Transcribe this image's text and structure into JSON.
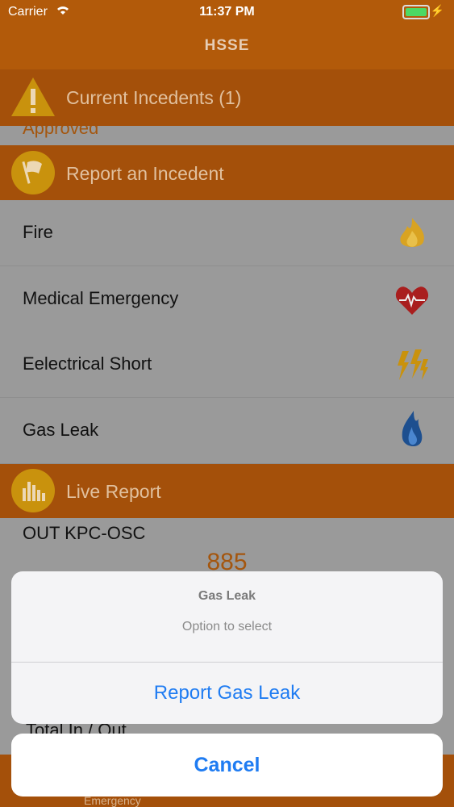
{
  "status_bar": {
    "carrier": "Carrier",
    "time": "11:37 PM"
  },
  "nav": {
    "title": "HSSE"
  },
  "current": {
    "label": "Current Incedents (1)",
    "status_text": "Approved"
  },
  "report": {
    "label": "Report an Incedent",
    "items": [
      {
        "label": "Fire",
        "icon": "fire-icon"
      },
      {
        "label": "Medical Emergency",
        "icon": "heartbeat-icon"
      },
      {
        "label": "Eelectrical Short",
        "icon": "lightning-icon"
      },
      {
        "label": "Gas Leak",
        "icon": "gas-flame-icon"
      }
    ]
  },
  "live": {
    "label": "Live Report",
    "row1_label": "OUT KPC-OSC",
    "row1_value": "885",
    "total_label": "Total In / Out"
  },
  "tabbar": {
    "emergency_label": "Emergency"
  },
  "action_sheet": {
    "title": "Gas Leak",
    "message": "Option to select",
    "action_label": "Report Gas Leak",
    "cancel_label": "Cancel"
  },
  "colors": {
    "accent": "#1f7cf2",
    "header": "#a4500a",
    "battery": "#4cd964"
  }
}
